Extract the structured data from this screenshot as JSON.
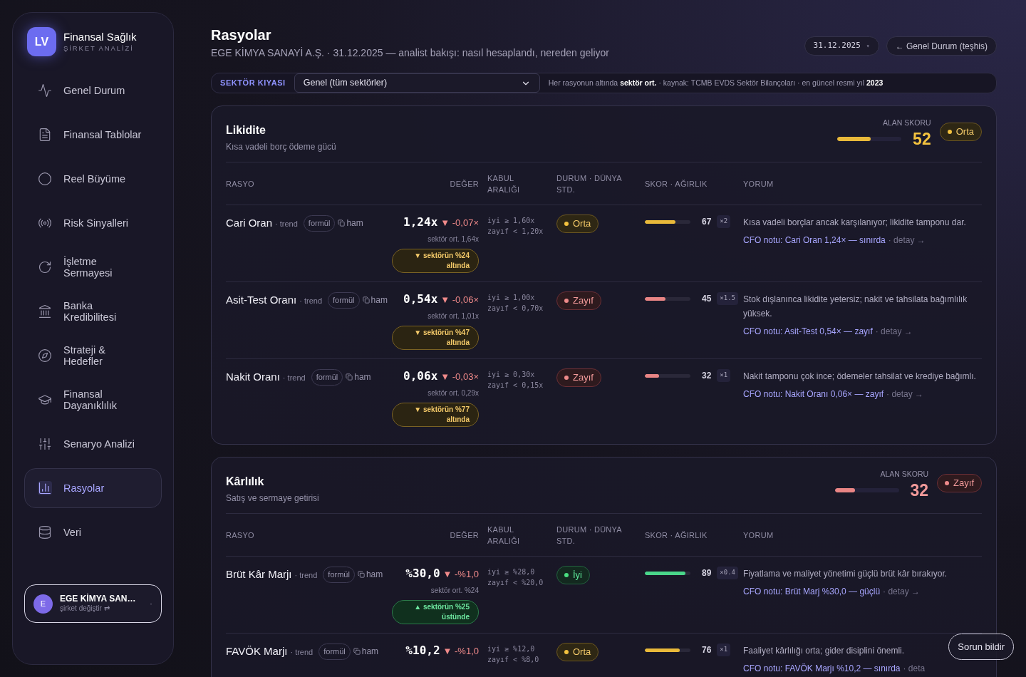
{
  "brand": {
    "logo": "LV",
    "title": "Finansal Sağlık",
    "subtitle": "ŞİRKET ANALİZİ"
  },
  "nav": [
    {
      "label": "Genel Durum",
      "selected": false
    },
    {
      "label": "Finansal Tablolar",
      "selected": false
    },
    {
      "label": "Reel Büyüme",
      "selected": false
    },
    {
      "label": "Risk Sinyalleri",
      "selected": false
    },
    {
      "label": "İşletme Sermayesi",
      "selected": false
    },
    {
      "label": "Banka Kredibilitesi",
      "selected": false
    },
    {
      "label": "Strateji & Hedefler",
      "selected": false
    },
    {
      "label": "Finansal Dayanıklılık",
      "selected": false
    },
    {
      "label": "Senaryo Analizi",
      "selected": false
    },
    {
      "label": "Rasyolar",
      "selected": true
    },
    {
      "label": "Veri",
      "selected": false
    }
  ],
  "company": {
    "avatar": "E",
    "name": "EGE KİMYA SAN…",
    "action": "şirket değiştir ⇄",
    "caret": "·"
  },
  "header": {
    "title": "Rasyolar",
    "subtitle": "EGE KİMYA SANAYİ A.Ş. · 31.12.2025 — analist bakışı: nasıl hesaplandı, nereden geliyor",
    "date": "31.12.2025",
    "date_caret": "▾",
    "back_link": "← Genel Durum (teşhis)"
  },
  "filter": {
    "label": "SEKTÖR KIYASI",
    "value": "Genel (tüm sektörler)",
    "note": "Her rasyonun altında **sektör ort.** · kaynak: TCMB EVDS Sektör Bilançoları · en güncel resmi yıl **2023**"
  },
  "sections": [
    {
      "title": "Likidite",
      "subtitle": "Kısa vadeli borç ödeme gücü",
      "score_label": "ALAN SKORU",
      "score": "52",
      "level": 0.52,
      "status": {
        "label": "Orta",
        "kind": "medium"
      },
      "columns": [
        "RASYO",
        "DEĞER",
        "KABUL ARALIĞI",
        "DURUM · DÜNYA STD.",
        "SKOR · AĞIRLIK",
        "YORUM"
      ],
      "rows": [
        {
          "name": "Cari Oran",
          "trend": "· trend",
          "formula": "formül",
          "raw": "ham",
          "value": "1,24x",
          "arrow": "▼",
          "delta": "-0,07×",
          "sector_avg": "sektör ort. 1,64x",
          "sector_badge": {
            "text": "▼ sektörün %24 altında",
            "kind": "below"
          },
          "good": "iyi ≥ 1,60x",
          "weak": "zayıf < 1,20x",
          "status": {
            "label": "Orta",
            "kind": "medium"
          },
          "score": "67",
          "level": 0.67,
          "weight": "×2",
          "comment": "Kısa vadeli borçlar ancak karşılanıyor; likidite tamponu dar.",
          "cfo_note": "CFO notu: Cari Oran 1,24× — sınırda",
          "detail": "· detay →"
        },
        {
          "name": "Asit-Test Oranı",
          "trend": "· trend",
          "formula": "formül",
          "raw": "ham",
          "value": "0,54x",
          "arrow": "▼",
          "delta": "-0,06×",
          "sector_avg": "sektör ort. 1,01x",
          "sector_badge": {
            "text": "▼ sektörün %47 altında",
            "kind": "below"
          },
          "good": "iyi ≥ 1,00x",
          "weak": "zayıf < 0,70x",
          "status": {
            "label": "Zayıf",
            "kind": "weak"
          },
          "score": "45",
          "level": 0.45,
          "weight": "×1.5",
          "comment": "Stok dışlanınca likidite yetersiz; nakit ve tahsilata bağımlılık yüksek.",
          "cfo_note": "CFO notu: Asit-Test 0,54× — zayıf",
          "detail": "· detay →"
        },
        {
          "name": "Nakit Oranı",
          "trend": "· trend",
          "formula": "formül",
          "raw": "ham",
          "value": "0,06x",
          "arrow": "▼",
          "delta": "-0,03×",
          "sector_avg": "sektör ort. 0,29x",
          "sector_badge": {
            "text": "▼ sektörün %77 altında",
            "kind": "below"
          },
          "good": "iyi ≥ 0,30x",
          "weak": "zayıf < 0,15x",
          "status": {
            "label": "Zayıf",
            "kind": "weak"
          },
          "score": "32",
          "level": 0.32,
          "weight": "×1",
          "comment": "Nakit tamponu çok ince; ödemeler tahsilat ve krediye bağımlı.",
          "cfo_note": "CFO notu: Nakit Oranı 0,06× — zayıf",
          "detail": "· detay →"
        }
      ]
    },
    {
      "title": "Kârlılık",
      "subtitle": "Satış ve sermaye getirisi",
      "score_label": "ALAN SKORU",
      "score": "32",
      "level": 0.32,
      "status": {
        "label": "Zayıf",
        "kind": "weak"
      },
      "columns": [
        "RASYO",
        "DEĞER",
        "KABUL ARALIĞI",
        "DURUM · DÜNYA STD.",
        "SKOR · AĞIRLIK",
        "YORUM"
      ],
      "rows": [
        {
          "name": "Brüt Kâr Marjı",
          "trend": "· trend",
          "formula": "formül",
          "raw": "ham",
          "value": "%30,0",
          "arrow": "▼",
          "delta": "-%1,0",
          "sector_avg": "sektör ort. %24",
          "sector_badge": {
            "text": "▲ sektörün %25 üstünde",
            "kind": "above"
          },
          "good": "iyi ≥ %28,0",
          "weak": "zayıf < %20,0",
          "status": {
            "label": "İyi",
            "kind": "good"
          },
          "score": "89",
          "level": 0.89,
          "weight": "×0.4",
          "comment": "Fiyatlama ve maliyet yönetimi güçlü brüt kâr bırakıyor.",
          "cfo_note": "CFO notu: Brüt Marj %30,0 — güçlü",
          "detail": "· detay →"
        },
        {
          "name": "FAVÖK Marjı",
          "trend": "· trend",
          "formula": "formül",
          "raw": "ham",
          "value": "%10,2",
          "arrow": "▼",
          "delta": "-%1,0",
          "good": "iyi ≥ %12,0",
          "weak": "zayıf < %8,0",
          "status": {
            "label": "Orta",
            "kind": "medium"
          },
          "score": "76",
          "level": 0.76,
          "weight": "×1",
          "comment": "Faaliyet kârlılığı orta; gider disiplini önemli.",
          "cfo_note": "CFO notu: FAVÖK Marjı %10,2 — sınırda",
          "detail": "· deta"
        }
      ]
    }
  ],
  "report_button": "Sorun bildir"
}
